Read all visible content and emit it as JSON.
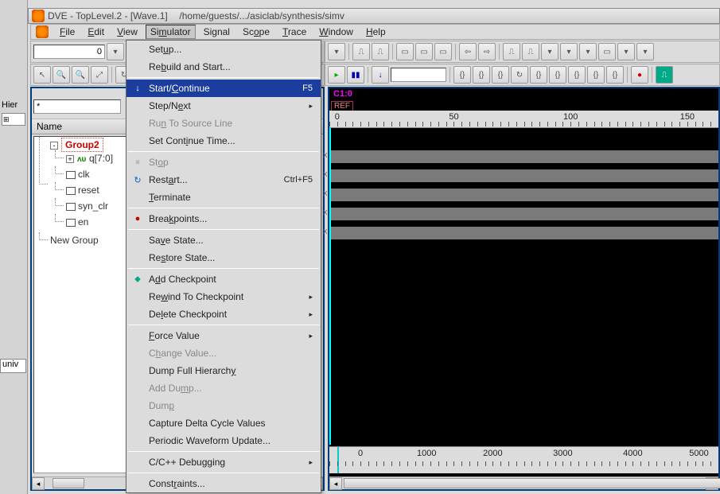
{
  "title": {
    "app": "DVE - TopLevel.2 - [Wave.1]",
    "path": "/home/guests/.../asiclab/synthesis/simv"
  },
  "menubar": [
    "File",
    "Edit",
    "View",
    "Simulator",
    "Signal",
    "Scope",
    "Trace",
    "Window",
    "Help"
  ],
  "time_input": "0",
  "time_unit_placeholder": "",
  "left_label": "Hier",
  "name_header": "Name",
  "univ_text": "univ",
  "search_text": "*",
  "tree": {
    "group": "Group2",
    "signals": [
      "q[7:0]",
      "clk",
      "reset",
      "syn_clr",
      "en"
    ],
    "newgroup": "New Group"
  },
  "wave": {
    "c1": "C1:0",
    "ref": "REF",
    "top_ticks": [
      0,
      50,
      100,
      150
    ],
    "bottom_ticks": [
      0,
      1000,
      2000,
      3000,
      4000,
      5000
    ]
  },
  "simmenu": {
    "setup": "Setup...",
    "rebuild": "Rebuild and Start...",
    "start": "Start/Continue",
    "start_sc": "F5",
    "step": "Step/Next",
    "runto": "Run To Source Line",
    "setcont": "Set Continue Time...",
    "stop": "Stop",
    "restart": "Restart...",
    "restart_sc": "Ctrl+F5",
    "terminate": "Terminate",
    "breakpoints": "Breakpoints...",
    "savestate": "Save State...",
    "restorestate": "Restore State...",
    "addcp": "Add Checkpoint",
    "rewindcp": "Rewind To Checkpoint",
    "deletecp": "Delete Checkpoint",
    "forceval": "Force Value",
    "changeval": "Change Value...",
    "dumpfull": "Dump Full Hierarchy",
    "adddump": "Add Dump...",
    "dump": "Dump",
    "capture": "Capture Delta Cycle Values",
    "periodic": "Periodic Waveform Update...",
    "ccdebug": "C/C++ Debugging",
    "constraints": "Constraints..."
  }
}
